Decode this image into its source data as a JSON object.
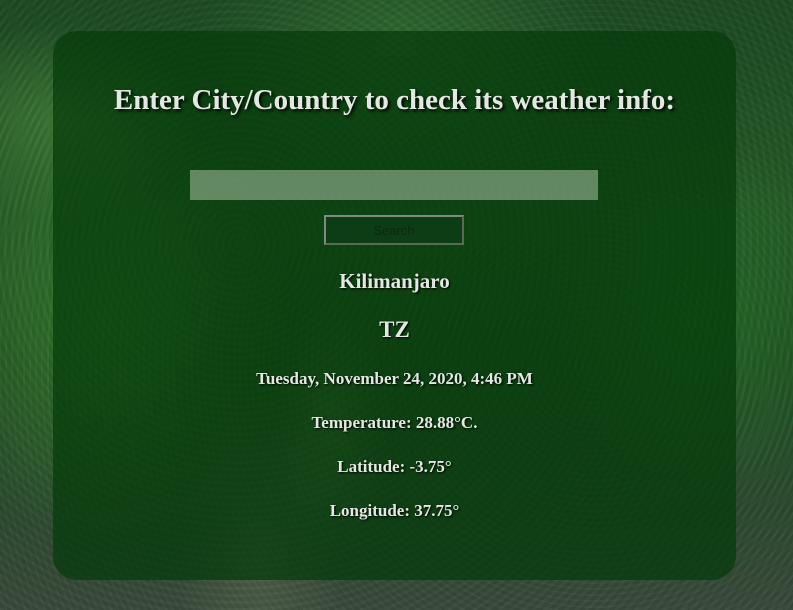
{
  "header": {
    "title": "Enter City/Country to check its weather info:"
  },
  "search": {
    "value": "",
    "placeholder": "",
    "button_label": "Search"
  },
  "result": {
    "city": "Kilimanjaro",
    "country": "TZ",
    "datetime": "Tuesday, November 24, 2020, 4:46 PM",
    "temperature": "Temperature: 28.88°C.",
    "latitude": "Latitude: -3.75°",
    "longitude": "Longitude: 37.75°"
  },
  "colors": {
    "card_background": "#043a0a",
    "text": "#e4e8e2",
    "input_background": "#aac3a5",
    "button_background": "#0d3d14"
  }
}
